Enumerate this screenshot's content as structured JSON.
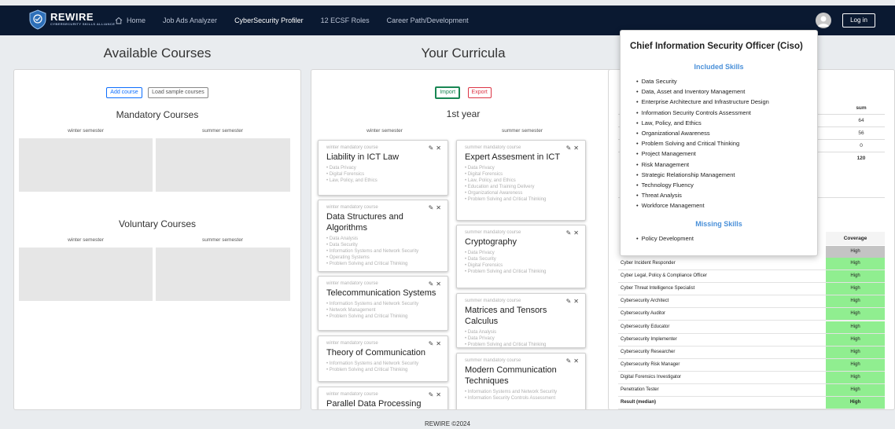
{
  "navbar": {
    "brand_title": "REWIRE",
    "brand_subtitle": "CYBERSECURITY SKILLS ALLIANCE",
    "items": [
      {
        "label": "Home"
      },
      {
        "label": "Job Ads Analyzer"
      },
      {
        "label": "CyberSecurity Profiler"
      },
      {
        "label": "12 ECSF Roles"
      },
      {
        "label": "Career Path/Development"
      }
    ],
    "login_label": "Log in"
  },
  "available": {
    "title": "Available Courses",
    "add_label": "Add course",
    "load_label": "Load sample courses",
    "mandatory_title": "Mandatory Courses",
    "voluntary_title": "Voluntary Courses",
    "winter_label": "winter semester",
    "summer_label": "summer semester"
  },
  "curricula": {
    "title": "Your Curricula",
    "import_label": "Import",
    "export_label": "Export",
    "year_title": "1st year",
    "winter_label": "winter semester",
    "summer_label": "summer semester",
    "winter_courses": [
      {
        "type": "winter mandatory course",
        "title": "Liability in ICT Law",
        "skills": [
          "• Data Privacy",
          "• Digital Forensics",
          "• Law, Policy, and Ethics"
        ]
      },
      {
        "type": "winter mandatory course",
        "title": "Data Structures and Algorithms",
        "skills": [
          "• Data Analysis",
          "• Data Security",
          "• Information Systems and Network Security",
          "• Operating Systems",
          "• Problem Solving and Critical Thinking"
        ]
      },
      {
        "type": "winter mandatory course",
        "title": "Telecommunication Systems",
        "skills": [
          "• Information Systems and Network Security",
          "• Network Management",
          "• Problem Solving and Critical Thinking"
        ]
      },
      {
        "type": "winter mandatory course",
        "title": "Theory of Communication",
        "skills": [
          "• Information Systems and Network Security",
          "• Problem Solving and Critical Thinking"
        ]
      },
      {
        "type": "winter mandatory course",
        "title": "Parallel Data Processing",
        "skills": []
      }
    ],
    "summer_courses": [
      {
        "type": "summer mandatory course",
        "title": "Expert Assesment in ICT",
        "skills": [
          "• Data Privacy",
          "• Digital Forensics",
          "• Law, Policy, and Ethics",
          "• Education and Training Delivery",
          "• Organizational Awareness",
          "• Problem Solving and Critical Thinking"
        ]
      },
      {
        "type": "summer mandatory course",
        "title": "Cryptography",
        "skills": [
          "• Data Privacy",
          "• Data Security",
          "• Digital Forensics",
          "• Problem Solving and Critical Thinking"
        ]
      },
      {
        "type": "summer mandatory course",
        "title": "Matrices and Tensors Calculus",
        "skills": [
          "• Data Analysis",
          "• Data Privacy",
          "• Problem Solving and Critical Thinking"
        ]
      },
      {
        "type": "summer mandatory course",
        "title": "Modern Communication Techniques",
        "skills": [
          "• Information Systems and Network Security",
          "• Information Security Controls Assessment"
        ]
      }
    ]
  },
  "summary": {
    "sum_header": "sum",
    "sum_values": [
      "64",
      "56",
      "0",
      "120"
    ],
    "coverage_header": "Coverage",
    "first_coverage": "High",
    "roles": [
      {
        "name": "Cyber Incident Responder",
        "coverage": "High"
      },
      {
        "name": "Cyber Legal, Policy & Compliance Officer",
        "coverage": "High"
      },
      {
        "name": "Cyber Threat Intelligence Specialist",
        "coverage": "High"
      },
      {
        "name": "Cybersecurity Architect",
        "coverage": "High"
      },
      {
        "name": "Cybersecurity Auditor",
        "coverage": "High"
      },
      {
        "name": "Cybersecurity Educator",
        "coverage": "High"
      },
      {
        "name": "Cybersecurity Implementer",
        "coverage": "High"
      },
      {
        "name": "Cybersecurity Researcher",
        "coverage": "High"
      },
      {
        "name": "Cybersecurity Risk Manager",
        "coverage": "High"
      },
      {
        "name": "Digital Forensics Investigator",
        "coverage": "High"
      },
      {
        "name": "Penetration Tester",
        "coverage": "High"
      },
      {
        "name": "Result (median)",
        "coverage": "High"
      }
    ]
  },
  "popover": {
    "title": "Chief Information Security Officer (Ciso)",
    "included_title": "Included Skills",
    "included": [
      "Data Security",
      "Data, Asset and Inventory Management",
      "Enterprise Architecture and Infrastructure Design",
      "Information Security Controls Assessment",
      "Law, Policy, and Ethics",
      "Organizational Awareness",
      "Problem Solving and Critical Thinking",
      "Project Management",
      "Risk Management",
      "Strategic Relationship Management",
      "Technology Fluency",
      "Threat Analysis",
      "Workforce Management"
    ],
    "missing_title": "Missing Skills",
    "missing": [
      "Policy Development"
    ]
  },
  "footer": "REWIRE ©2024",
  "colors": {
    "navbar": "#0a1931",
    "coverage_high": "#90ee90",
    "accent": "#4a90d9"
  }
}
